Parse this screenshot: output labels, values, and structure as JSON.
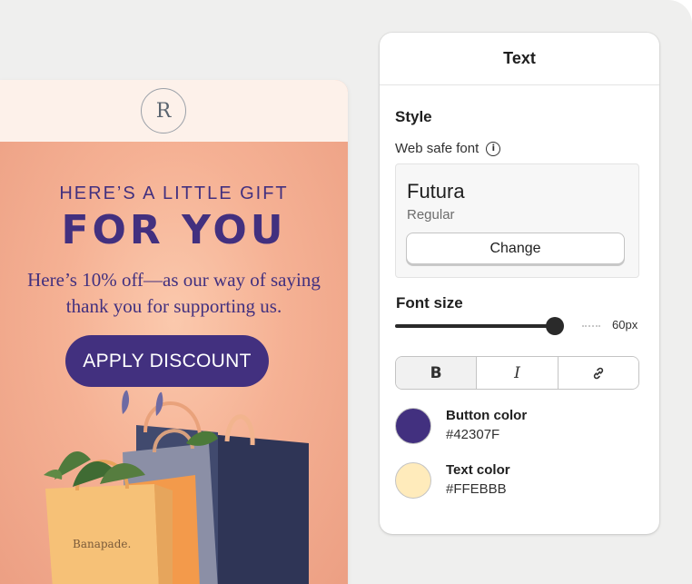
{
  "email": {
    "logo_letter": "R",
    "kicker": "HERE’S A LITTLE GIFT",
    "headline": "FOR YOU",
    "body_line1": "Here’s 10% off—as our way of saying",
    "body_line2": "thank you for supporting us.",
    "cta_label": "APPLY DISCOUNT",
    "bag_brand": "Banapade."
  },
  "panel": {
    "title": "Text",
    "style_heading": "Style",
    "web_safe_label": "Web safe font",
    "info_icon_glyph": "i",
    "font": {
      "name": "Futura",
      "weight": "Regular",
      "change_label": "Change"
    },
    "font_size": {
      "label": "Font size",
      "value_text": "60px",
      "level": 0.88
    },
    "format_buttons": [
      {
        "name": "bold",
        "glyph": "B"
      },
      {
        "name": "italic",
        "glyph": "I"
      },
      {
        "name": "link",
        "icon": "link-icon"
      }
    ],
    "button_color": {
      "label": "Button color",
      "hex": "#42307F",
      "swatch": "#42307f"
    },
    "text_color": {
      "label": "Text color",
      "hex": "#FFEBBB",
      "swatch": "#ffebbb"
    }
  }
}
